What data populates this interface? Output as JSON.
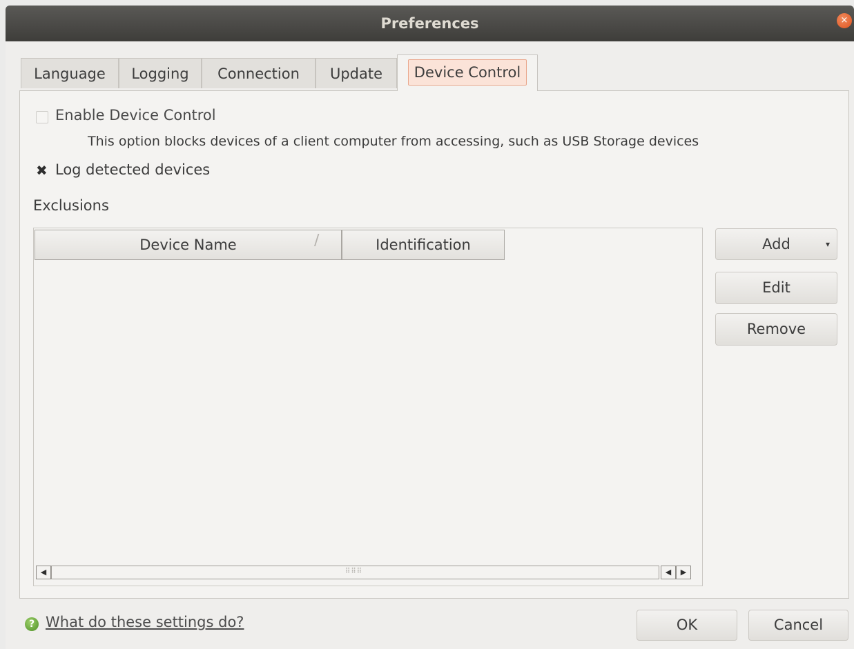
{
  "window": {
    "title": "Preferences",
    "close_glyph": "×"
  },
  "tabs": [
    {
      "label": "Language",
      "active": false
    },
    {
      "label": "Logging",
      "active": false
    },
    {
      "label": "Connection",
      "active": false
    },
    {
      "label": "Update",
      "active": false
    },
    {
      "label": "Device Control",
      "active": true
    }
  ],
  "device_control": {
    "enable_label": "Enable Device Control",
    "enable_checked": false,
    "enable_description": "This option blocks devices of a client computer from accessing, such as USB Storage devices",
    "log_label": "Log detected devices",
    "log_checked": true,
    "log_check_glyph": "✖"
  },
  "exclusions": {
    "label": "Exclusions",
    "columns": [
      "Device Name",
      "Identification"
    ],
    "sort_indicator": "∕",
    "rows": [],
    "buttons": {
      "add": "Add",
      "add_arrow": "▾",
      "edit": "Edit",
      "remove": "Remove"
    },
    "scroll_glyphs": {
      "left": "◀",
      "right": "▶",
      "grip": "⠿⠿⠿"
    }
  },
  "footer": {
    "help_icon_glyph": "?",
    "help_link": "What do these settings do?",
    "ok": "OK",
    "cancel": "Cancel"
  },
  "colors": {
    "titlebar": "#3e3d3a",
    "close": "#e0541f",
    "active_tab_highlight": "#fbe3d8",
    "help_icon": "#4d8f26"
  },
  "icons": {
    "close": "close-icon",
    "help": "help-icon",
    "sort": "sort-icon",
    "add_dropdown": "chevron-down-icon"
  }
}
